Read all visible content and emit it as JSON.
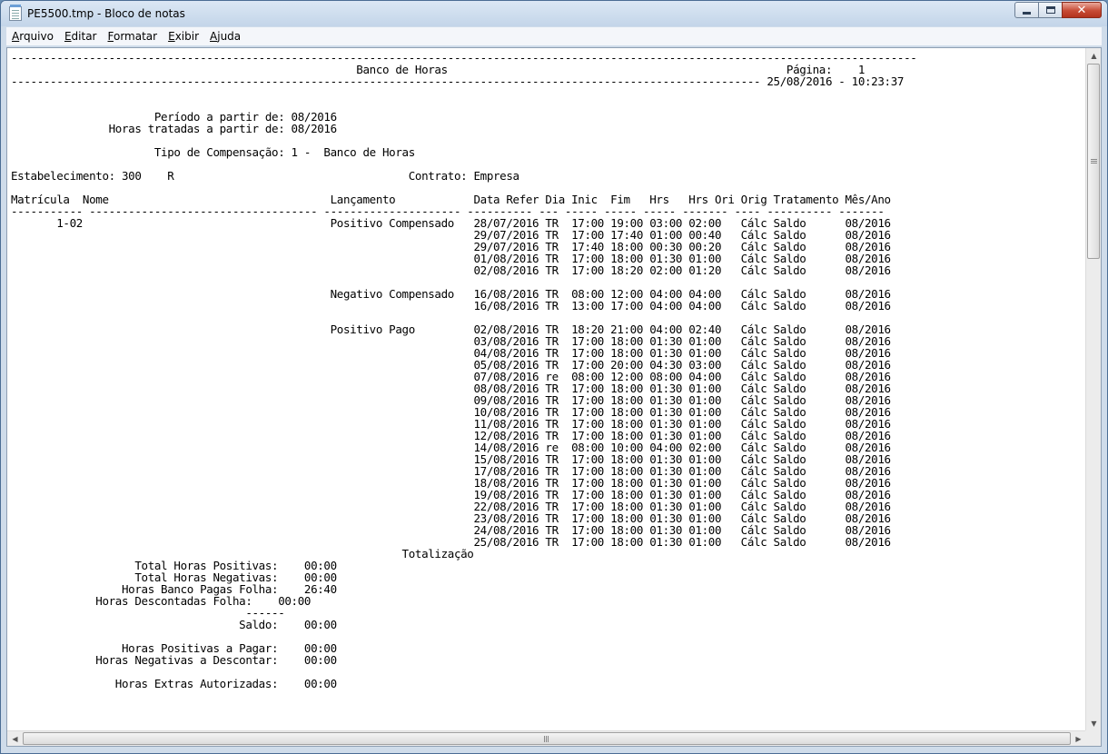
{
  "window": {
    "title": "PE5500.tmp - Bloco de notas"
  },
  "menu": [
    {
      "label": "Arquivo",
      "key": "A",
      "rest": "rquivo"
    },
    {
      "label": "Editar",
      "key": "E",
      "rest": "ditar"
    },
    {
      "label": "Formatar",
      "key": "F",
      "rest": "ormatar"
    },
    {
      "label": "Exibir",
      "key": "E",
      "rest": "xibir"
    },
    {
      "label": "Ajuda",
      "key": "A",
      "rest": "juda"
    }
  ],
  "icons": {
    "app": "notepad-icon",
    "minimize": "minimize-icon",
    "maximize": "maximize-icon",
    "close": "close-icon"
  },
  "colors": {
    "close_button": "#c74b35",
    "titlebar": "#c3d5e9"
  },
  "document": {
    "lines": [
      "-------------------------------------------------------------------------------------------------------------------------------------------",
      "                                                     Banco de Horas                                                    Página:    1",
      "------------------------------------------------------------------------------------------------------------------- 25/08/2016 - 10:23:37",
      "",
      "",
      "                      Período a partir de: 08/2016",
      "               Horas tratadas a partir de: 08/2016",
      "",
      "                      Tipo de Compensação: 1 -  Banco de Horas",
      "",
      "Estabelecimento: 300    R                                    Contrato: Empresa",
      "",
      "Matrícula  Nome                                  Lançamento            Data Refer Dia Inic  Fim   Hrs   Hrs Ori Orig Tratamento Mês/Ano",
      "----------- ----------------------------------- --------------------- ---------- --- ----- ----- ----- ------- ---- ---------- -------",
      "       1-02                                      Positivo Compensado   28/07/2016 TR  17:00 19:00 03:00 02:00   Cálc Saldo      08/2016",
      "                                                                       29/07/2016 TR  17:00 17:40 01:00 00:40   Cálc Saldo      08/2016",
      "                                                                       29/07/2016 TR  17:40 18:00 00:30 00:20   Cálc Saldo      08/2016",
      "                                                                       01/08/2016 TR  17:00 18:00 01:30 01:00   Cálc Saldo      08/2016",
      "                                                                       02/08/2016 TR  17:00 18:20 02:00 01:20   Cálc Saldo      08/2016",
      "",
      "                                                 Negativo Compensado   16/08/2016 TR  08:00 12:00 04:00 04:00   Cálc Saldo      08/2016",
      "                                                                       16/08/2016 TR  13:00 17:00 04:00 04:00   Cálc Saldo      08/2016",
      "",
      "                                                 Positivo Pago         02/08/2016 TR  18:20 21:00 04:00 02:40   Cálc Saldo      08/2016",
      "                                                                       03/08/2016 TR  17:00 18:00 01:30 01:00   Cálc Saldo      08/2016",
      "                                                                       04/08/2016 TR  17:00 18:00 01:30 01:00   Cálc Saldo      08/2016",
      "                                                                       05/08/2016 TR  17:00 20:00 04:30 03:00   Cálc Saldo      08/2016",
      "                                                                       07/08/2016 re  08:00 12:00 08:00 04:00   Cálc Saldo      08/2016",
      "                                                                       08/08/2016 TR  17:00 18:00 01:30 01:00   Cálc Saldo      08/2016",
      "                                                                       09/08/2016 TR  17:00 18:00 01:30 01:00   Cálc Saldo      08/2016",
      "                                                                       10/08/2016 TR  17:00 18:00 01:30 01:00   Cálc Saldo      08/2016",
      "                                                                       11/08/2016 TR  17:00 18:00 01:30 01:00   Cálc Saldo      08/2016",
      "                                                                       12/08/2016 TR  17:00 18:00 01:30 01:00   Cálc Saldo      08/2016",
      "                                                                       14/08/2016 re  08:00 10:00 04:00 02:00   Cálc Saldo      08/2016",
      "                                                                       15/08/2016 TR  17:00 18:00 01:30 01:00   Cálc Saldo      08/2016",
      "                                                                       17/08/2016 TR  17:00 18:00 01:30 01:00   Cálc Saldo      08/2016",
      "                                                                       18/08/2016 TR  17:00 18:00 01:30 01:00   Cálc Saldo      08/2016",
      "                                                                       19/08/2016 TR  17:00 18:00 01:30 01:00   Cálc Saldo      08/2016",
      "                                                                       22/08/2016 TR  17:00 18:00 01:30 01:00   Cálc Saldo      08/2016",
      "                                                                       23/08/2016 TR  17:00 18:00 01:30 01:00   Cálc Saldo      08/2016",
      "                                                                       24/08/2016 TR  17:00 18:00 01:30 01:00   Cálc Saldo      08/2016",
      "                                                                       25/08/2016 TR  17:00 18:00 01:30 01:00   Cálc Saldo      08/2016",
      "                                                            Totalização",
      "                   Total Horas Positivas:    00:00",
      "                   Total Horas Negativas:    00:00",
      "                 Horas Banco Pagas Folha:    26:40",
      "             Horas Descontadas Folha:    00:00",
      "                                    ------",
      "                                   Saldo:    00:00",
      "",
      "                 Horas Positivas a Pagar:    00:00",
      "             Horas Negativas a Descontar:    00:00",
      "",
      "                Horas Extras Autorizadas:    00:00"
    ]
  }
}
